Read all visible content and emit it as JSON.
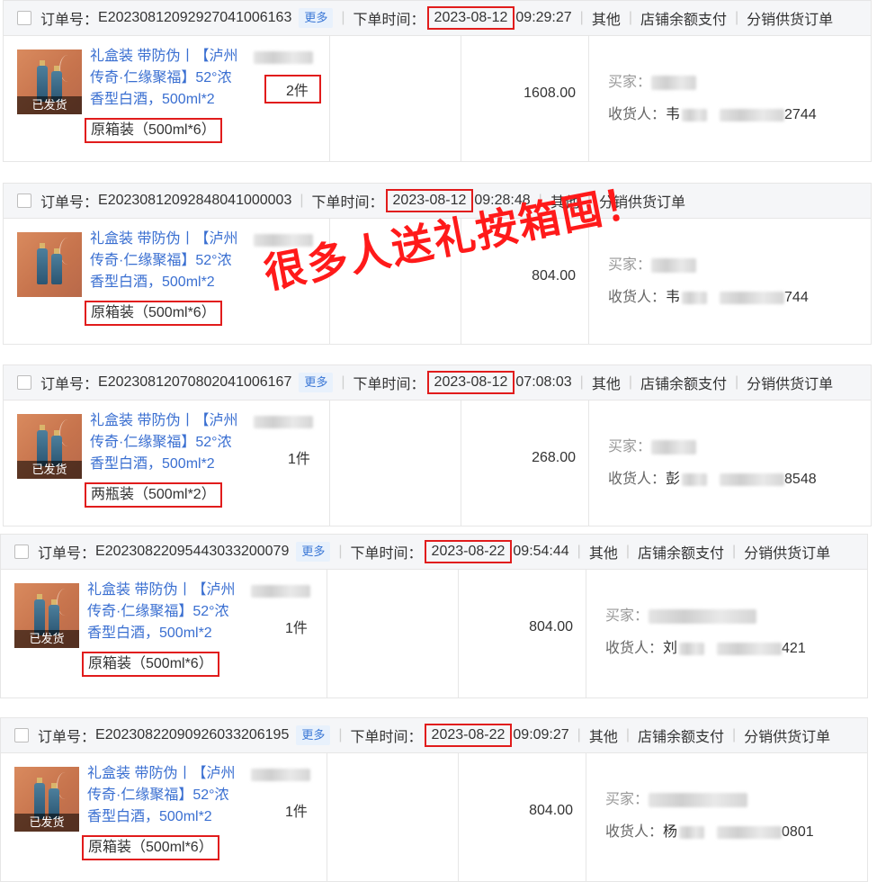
{
  "labels": {
    "order_no": "订单号：",
    "order_time": "下单时间：",
    "more": "更多",
    "shipped": "已发货",
    "buyer": "买家：",
    "receiver": "收货人：",
    "tag_other": "其他",
    "tag_balance": "店铺余额支付",
    "tag_dist": "分销供货订单"
  },
  "product_title": "礼盒装 带防伪丨【泸州 传奇·仁缘聚福】52°浓香型白酒，500ml*2",
  "product_title_l1": "礼盒装 带防伪丨【泸州",
  "product_title_l2": "传奇·仁缘聚福】52°浓",
  "product_title_l3": "香型白酒，500ml*2",
  "slogan": "很多人送礼按箱囤！",
  "orders": [
    {
      "order_id": "E2023081209292704100616З",
      "date": "2023-08-12",
      "time": "09:29:27",
      "show_more": true,
      "tags": [
        "其他",
        "店铺余额支付",
        "分销供货订单"
      ],
      "variant": "原箱装（500ml*6）",
      "qty": "2件",
      "amount": "1608.00",
      "receiver_name": "韦",
      "receiver_tail": "2744",
      "shipped": true
    },
    {
      "order_id": "E2023081209284804100000З",
      "date": "2023-08-12",
      "time": "09:28:48",
      "show_more": false,
      "tags": [
        "其他",
        "分销供货订单"
      ],
      "variant": "原箱装（500ml*6）",
      "qty": "",
      "amount": "804.00",
      "receiver_name": "韦",
      "receiver_tail": "744",
      "shipped": false
    },
    {
      "order_id": "E2023081207080204100616 7",
      "date": "2023-08-12",
      "time": "07:08:03",
      "show_more": true,
      "tags": [
        "其他",
        "店铺余额支付",
        "分销供货订单"
      ],
      "variant": "两瓶装（500ml*2）",
      "qty": "1件",
      "amount": "268.00",
      "receiver_name": "彭",
      "receiver_tail": "8548",
      "shipped": true
    },
    {
      "order_id": "E20230822095443033200079",
      "date": "2023-08-22",
      "time": "09:54:44",
      "show_more": true,
      "tags": [
        "其他",
        "店铺余额支付",
        "分销供货订单"
      ],
      "variant": "原箱装（500ml*6）",
      "qty": "1件",
      "amount": "804.00",
      "receiver_name": "刘",
      "receiver_tail": "421",
      "shipped": true
    },
    {
      "order_id": "E20230822090926033206195",
      "date": "2023-08-22",
      "time": "09:09:27",
      "show_more": true,
      "tags": [
        "其他",
        "店铺余额支付",
        "分销供货订单"
      ],
      "variant": "原箱装（500ml*6）",
      "qty": "1件",
      "amount": "804.00",
      "receiver_name": "杨",
      "receiver_tail": "0801",
      "shipped": true
    }
  ]
}
